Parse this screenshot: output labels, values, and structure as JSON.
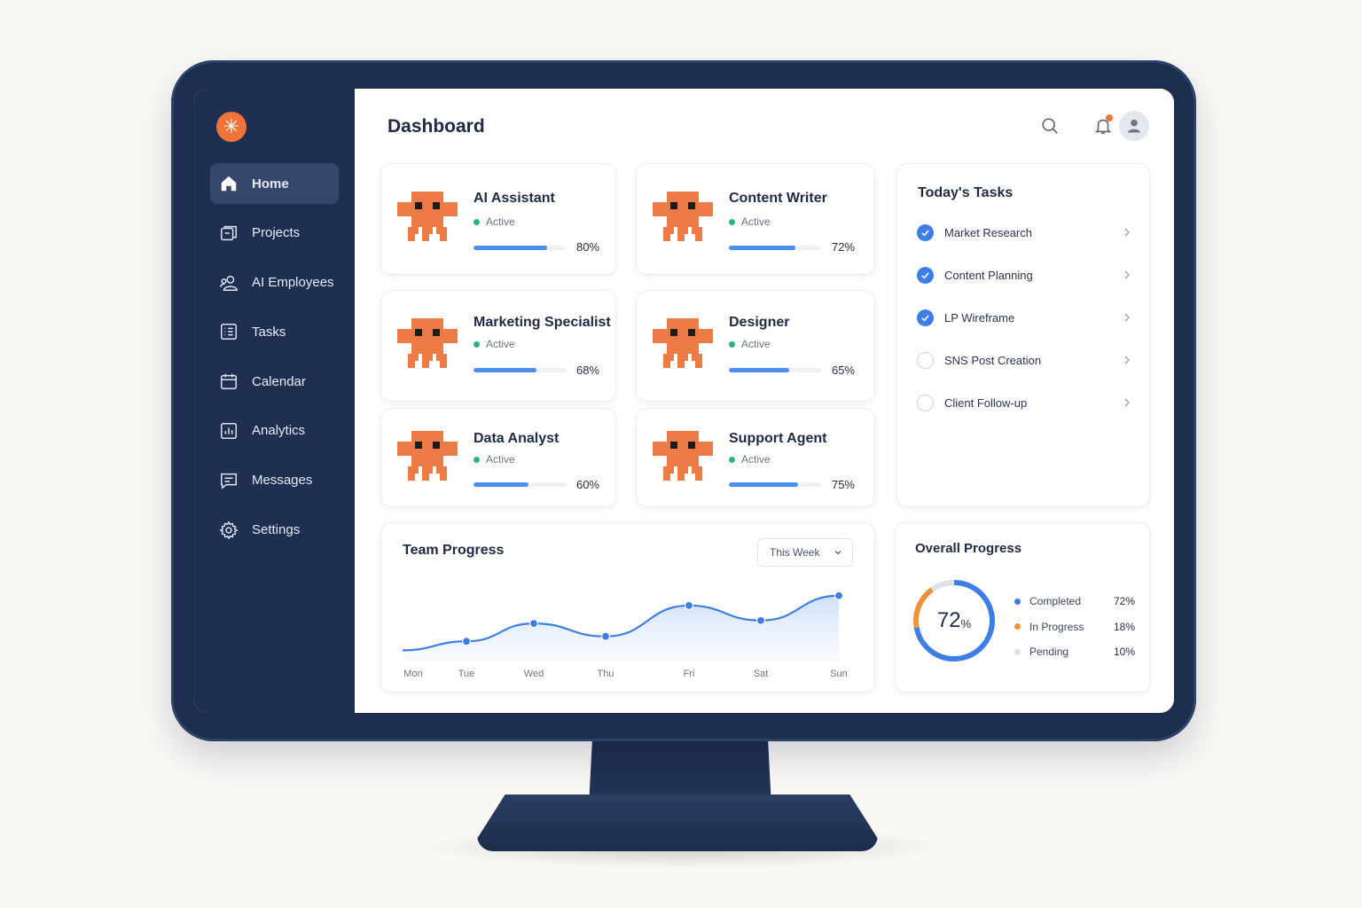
{
  "sidebar": {
    "logo_glyph": "✳",
    "items": [
      {
        "label": "Home",
        "icon": "home-icon",
        "active": true
      },
      {
        "label": "Projects",
        "icon": "projects-icon"
      },
      {
        "label": "AI Employees",
        "icon": "users-icon"
      },
      {
        "label": "Tasks",
        "icon": "tasks-icon"
      },
      {
        "label": "Calendar",
        "icon": "calendar-icon"
      },
      {
        "label": "Analytics",
        "icon": "analytics-icon"
      },
      {
        "label": "Messages",
        "icon": "messages-icon"
      },
      {
        "label": "Settings",
        "icon": "gear-icon"
      }
    ]
  },
  "header": {
    "title": "Dashboard",
    "icons": [
      "search-icon",
      "bell-icon",
      "avatar"
    ]
  },
  "employees": [
    {
      "name": "AI Assistant",
      "status": "Active",
      "progress": 80,
      "progress_label": "80%"
    },
    {
      "name": "Content Writer",
      "status": "Active",
      "progress": 72,
      "progress_label": "72%"
    },
    {
      "name": "Marketing Specialist",
      "status": "Active",
      "progress": 68,
      "progress_label": "68%"
    },
    {
      "name": "Designer",
      "status": "Active",
      "progress": 65,
      "progress_label": "65%"
    },
    {
      "name": "Data Analyst",
      "status": "Active",
      "progress": 60,
      "progress_label": "60%"
    },
    {
      "name": "Support Agent",
      "status": "Active",
      "progress": 75,
      "progress_label": "75%"
    }
  ],
  "tasks": {
    "title": "Today's Tasks",
    "items": [
      {
        "label": "Market Research",
        "done": true
      },
      {
        "label": "Content Planning",
        "done": true
      },
      {
        "label": "LP Wireframe",
        "done": true
      },
      {
        "label": "SNS Post Creation",
        "done": false
      },
      {
        "label": "Client Follow-up",
        "done": false
      }
    ]
  },
  "team_progress": {
    "title": "Team Progress",
    "range_selected": "This Week"
  },
  "overall": {
    "title": "Overall Progress",
    "center_value": "72",
    "center_unit": "%",
    "legend": [
      {
        "label": "Completed",
        "value": "72%",
        "color": "#3d7ee6"
      },
      {
        "label": "In Progress",
        "value": "18%",
        "color": "#f0923a"
      },
      {
        "label": "Pending",
        "value": "10%",
        "color": "#dde2ea"
      }
    ]
  },
  "chart_data": [
    {
      "type": "line",
      "title": "Team Progress",
      "categories": [
        "Mon",
        "Tue",
        "Wed",
        "Thu",
        "Fri",
        "Sat",
        "Sun"
      ],
      "series": [
        {
          "values": [
            30,
            39,
            57,
            44,
            75,
            60,
            85
          ]
        }
      ],
      "marker_from_index": 1,
      "grid": false,
      "area_fill": true
    },
    {
      "type": "pie",
      "donut": true,
      "labels": [
        "Completed",
        "In Progress",
        "Pending"
      ],
      "values": [
        72,
        18,
        10
      ],
      "colors": [
        "#3d7ee6",
        "#f0923a",
        "#dde2ea"
      ]
    }
  ],
  "colors": {
    "accent": "#3d7ee6",
    "brand": "#f0733a",
    "sidebar": "#1e2f52",
    "active_status": "#2db37a"
  }
}
